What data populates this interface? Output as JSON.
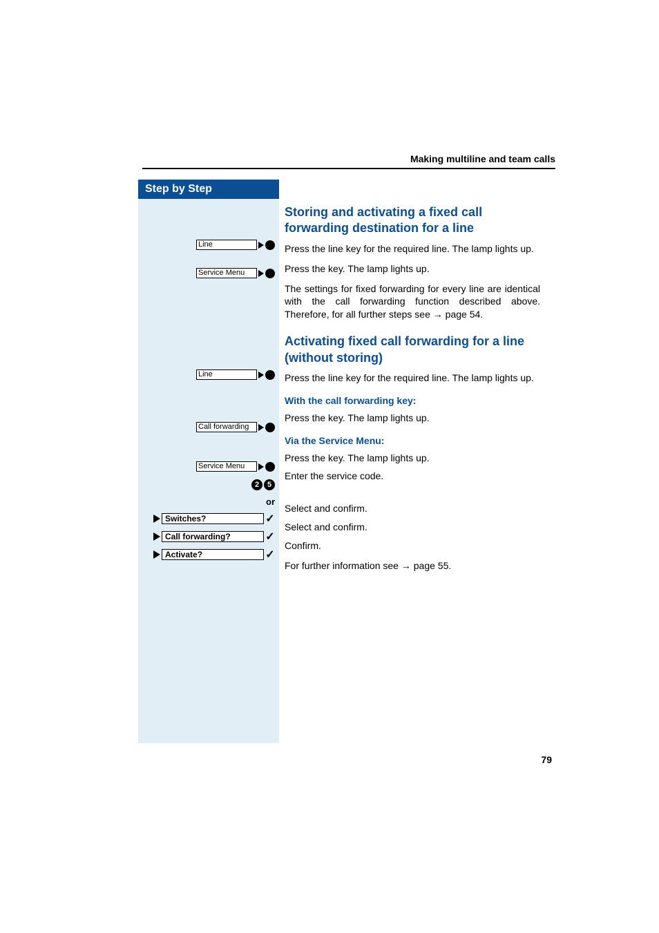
{
  "header": {
    "running_title": "Making multiline and team calls"
  },
  "sidebar": {
    "title": "Step by Step",
    "line_label": "Line",
    "service_menu_label": "Service Menu",
    "call_forwarding_label": "Call forwarding",
    "digit_a": "2",
    "digit_b": "5",
    "or_label": "or",
    "menu_switches": "Switches?",
    "menu_call_forwarding": "Call forwarding?",
    "menu_activate": "Activate?"
  },
  "content": {
    "h3a": "Storing and activating a fixed call forwarding destination for a line",
    "p1": "Press the line key for the required line. The lamp lights up.",
    "p2": "Press the key. The lamp lights up.",
    "p3_pre": "The settings for fixed forwarding for every line are identical with the call forwarding function described above. Therefore, for all further steps see ",
    "p3_link": "page 54.",
    "h3b": "Activating fixed call forwarding for a line (without storing)",
    "p4": "Press the line key for the required line. The lamp lights up.",
    "h4a": "With the call forwarding key:",
    "p5": "Press the key. The lamp lights up.",
    "h4b": "Via the Service Menu:",
    "p6": "Press the key. The lamp lights up.",
    "p7": "Enter the service code.",
    "p8": "Select and confirm.",
    "p9": "Select and confirm.",
    "p10": "Confirm.",
    "p11_pre": "For further information see ",
    "p11_link": "page 55."
  },
  "page_number": "79"
}
